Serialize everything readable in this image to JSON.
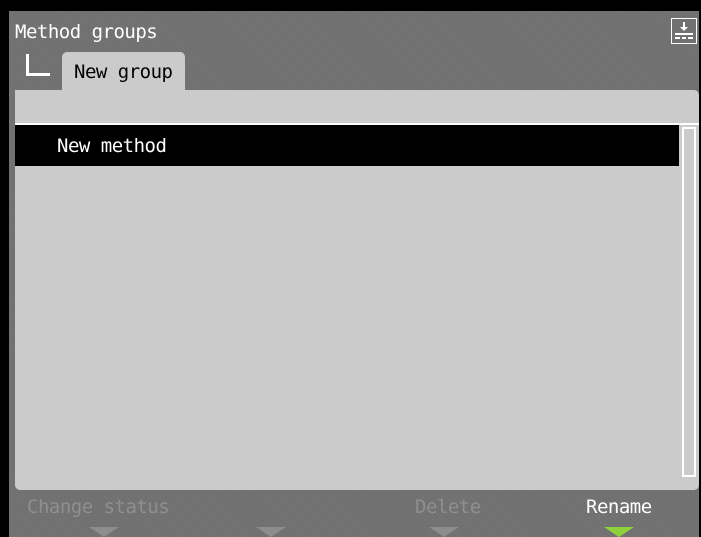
{
  "header": {
    "title": "Method groups",
    "system_icon": "download-tray-icon"
  },
  "breadcrumb": {
    "tree_icon": "tree-branch-icon",
    "tab_label": "New group"
  },
  "list": {
    "items": [
      {
        "label": "New method",
        "selected": true
      }
    ]
  },
  "softkeys": [
    {
      "label": "Change status",
      "enabled": false
    },
    {
      "label": "",
      "enabled": false
    },
    {
      "label": "Delete",
      "enabled": false
    },
    {
      "label": "Rename",
      "enabled": true
    }
  ],
  "colors": {
    "screen_bg": "#707070",
    "panel_bg": "#cbcbcb",
    "selection_bg": "#000000",
    "active_arrow": "#8fd13a",
    "disabled_text": "#8f8f8f"
  }
}
